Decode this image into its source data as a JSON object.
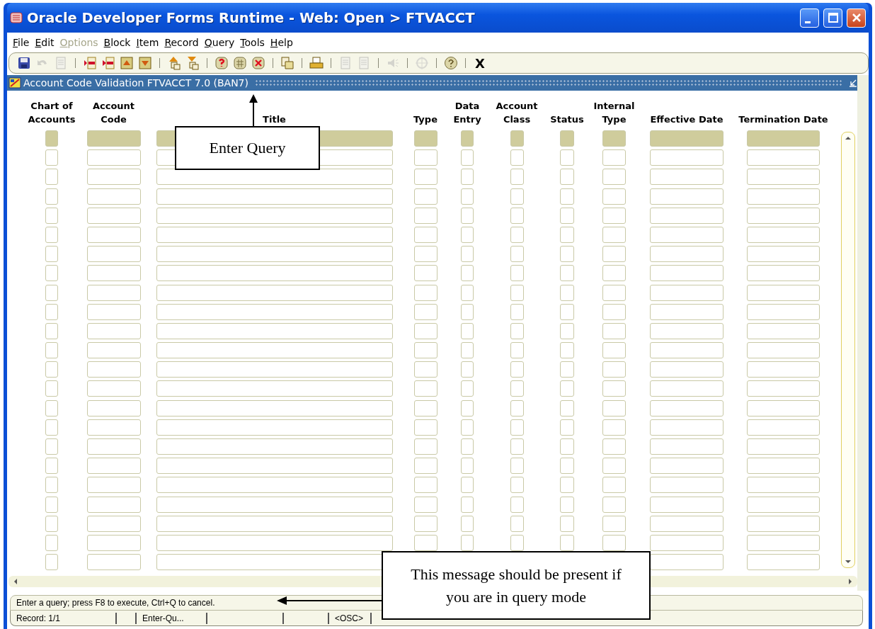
{
  "window": {
    "title": "Oracle Developer Forms Runtime - Web:  Open > FTVACCT"
  },
  "menu": [
    {
      "label": "File",
      "disabled": false
    },
    {
      "label": "Edit",
      "disabled": false
    },
    {
      "label": "Options",
      "disabled": true
    },
    {
      "label": "Block",
      "disabled": false
    },
    {
      "label": "Item",
      "disabled": false
    },
    {
      "label": "Record",
      "disabled": false
    },
    {
      "label": "Query",
      "disabled": false
    },
    {
      "label": "Tools",
      "disabled": false
    },
    {
      "label": "Help",
      "disabled": false
    }
  ],
  "toolbar": {
    "groups": [
      [
        {
          "kind": "save",
          "disabled": false
        },
        {
          "kind": "undo",
          "disabled": true
        },
        {
          "kind": "page",
          "disabled": true
        }
      ],
      [
        {
          "kind": "insert",
          "disabled": false
        },
        {
          "kind": "remove",
          "disabled": false
        },
        {
          "kind": "up",
          "disabled": false
        },
        {
          "kind": "down",
          "disabled": false
        }
      ],
      [
        {
          "kind": "stack-up",
          "disabled": false
        },
        {
          "kind": "stack-down",
          "disabled": false
        }
      ],
      [
        {
          "kind": "query",
          "disabled": false
        },
        {
          "kind": "execute",
          "disabled": false
        },
        {
          "kind": "cancel",
          "disabled": false
        }
      ],
      [
        {
          "kind": "copy",
          "disabled": false
        }
      ],
      [
        {
          "kind": "print",
          "disabled": false
        }
      ],
      [
        {
          "kind": "doc",
          "disabled": true
        },
        {
          "kind": "doc",
          "disabled": true
        }
      ],
      [
        {
          "kind": "speaker",
          "disabled": true
        }
      ],
      [
        {
          "kind": "target",
          "disabled": true
        }
      ],
      [
        {
          "kind": "help",
          "disabled": false
        }
      ]
    ],
    "exit_label": "X"
  },
  "form": {
    "title": "Account Code Validation  FTVACCT  7.0  (BAN7)",
    "columns": [
      {
        "label": "Chart of Accounts"
      },
      {
        "label": "Account Code"
      },
      {
        "label": "Title"
      },
      {
        "label": "Type"
      },
      {
        "label": "Data Entry"
      },
      {
        "label": "Account Class"
      },
      {
        "label": "Status"
      },
      {
        "label": "Internal Type"
      },
      {
        "label": "Effective Date"
      },
      {
        "label": "Termination Date"
      }
    ],
    "rows": [
      {
        "kind": "query"
      },
      {
        "kind": "record"
      },
      {
        "kind": "record"
      },
      {
        "kind": "record"
      },
      {
        "kind": "record"
      },
      {
        "kind": "record"
      },
      {
        "kind": "record"
      },
      {
        "kind": "record"
      },
      {
        "kind": "record"
      },
      {
        "kind": "record"
      },
      {
        "kind": "record"
      },
      {
        "kind": "record"
      },
      {
        "kind": "record"
      },
      {
        "kind": "record"
      },
      {
        "kind": "record"
      },
      {
        "kind": "record"
      },
      {
        "kind": "record"
      },
      {
        "kind": "record"
      },
      {
        "kind": "record"
      },
      {
        "kind": "record"
      },
      {
        "kind": "record"
      },
      {
        "kind": "record"
      },
      {
        "kind": "record"
      }
    ]
  },
  "message": "Enter a query;  press F8 to execute, Ctrl+Q to cancel.",
  "status_bar": [
    {
      "kind": "text",
      "text": "Record: 1/1"
    },
    {
      "kind": "blank"
    },
    {
      "kind": "text",
      "text": "Enter-Qu..."
    },
    {
      "kind": "blank"
    },
    {
      "kind": "blank"
    },
    {
      "kind": "text",
      "text": "<OSC>"
    }
  ],
  "callouts": [
    {
      "kind": "up",
      "text": "Enter Query"
    },
    {
      "kind": "left",
      "text": "This message should be present if you are in query mode"
    }
  ]
}
